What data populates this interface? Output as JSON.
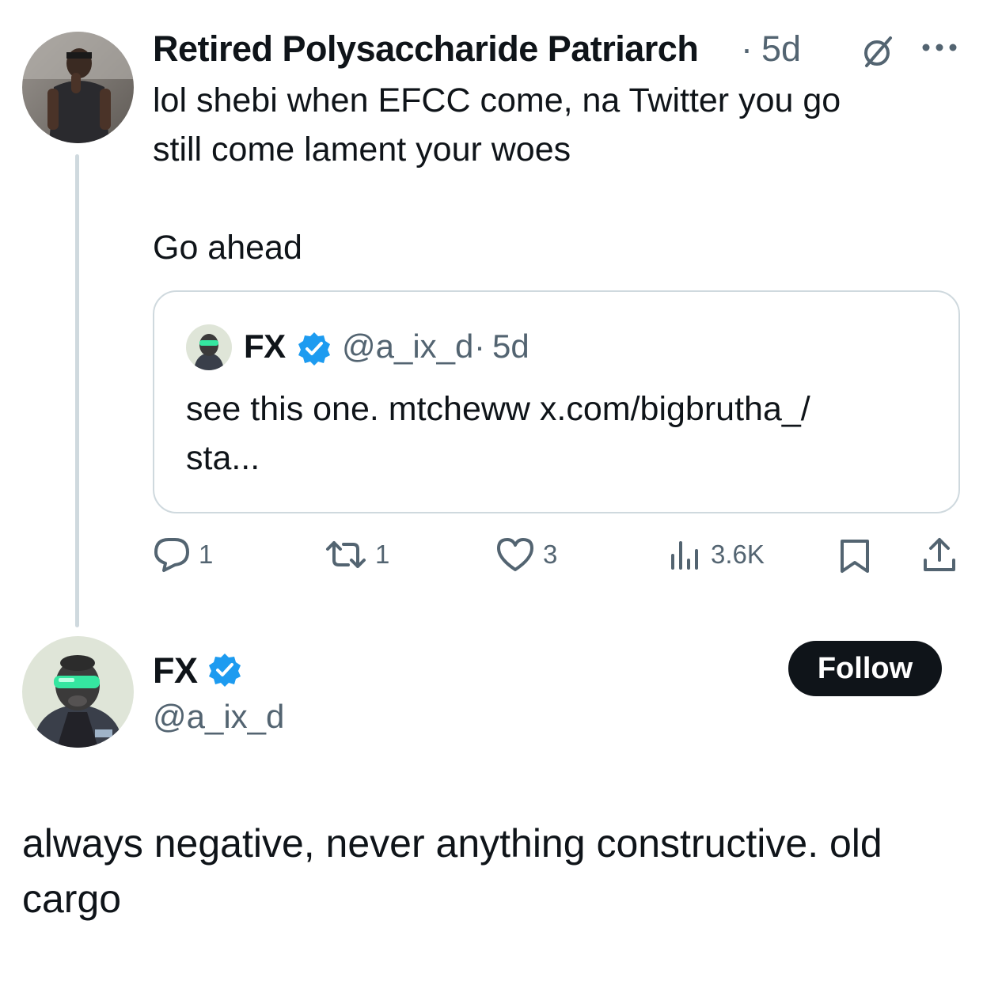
{
  "reply_tweet": {
    "author_name": "Retired Polysaccharide Patriarch",
    "separator": "·",
    "time": "5d",
    "text_line1": "lol shebi when EFCC come, na Twitter you go",
    "text_line2": "still come lament your woes",
    "text_line3": "Go ahead",
    "quoted": {
      "author_name": "FX",
      "handle": "@a_ix_d",
      "separator": "·",
      "time": "5d",
      "text_line1": "see this one. mtcheww x.com/bigbrutha_/",
      "text_line2": "sta..."
    },
    "actions": {
      "replies": "1",
      "reposts": "1",
      "likes": "3",
      "views": "3.6K"
    }
  },
  "main_tweet": {
    "author_name": "FX",
    "handle": "@a_ix_d",
    "follow_label": "Follow",
    "text_line1": "always negative, never anything constructive. old",
    "text_line2": "cargo"
  },
  "colors": {
    "verified": "#1d9bf0",
    "muted": "#536471",
    "border": "#cfd9de",
    "goggles": "#35e6a0"
  }
}
